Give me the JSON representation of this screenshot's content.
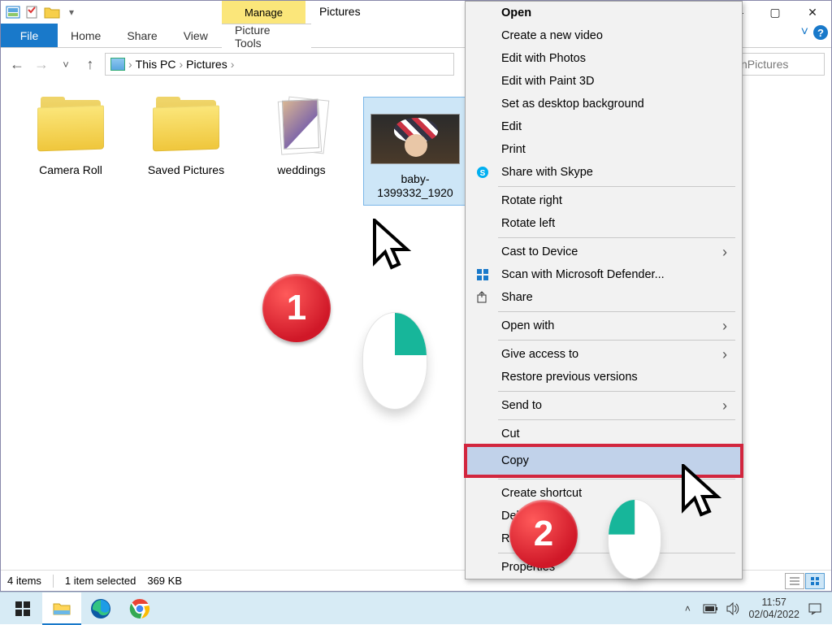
{
  "titlebar": {
    "contextual_tab": "Manage",
    "title": "Pictures"
  },
  "win_controls": {
    "min": "—",
    "max": "▢",
    "close": "✕"
  },
  "ribbon": {
    "file": "File",
    "tabs": [
      "Home",
      "Share",
      "View"
    ],
    "context_tab": "Picture Tools",
    "expand_glyph": "˅",
    "help_glyph": "?"
  },
  "nav": {
    "back_glyph": "←",
    "fwd_glyph": "→",
    "recent_glyph": "˅",
    "up_glyph": "↑",
    "sep_glyph": "›",
    "crumbs": [
      "This PC",
      "Pictures"
    ],
    "search_placeholder": "Pictures",
    "search_prefix_visible": "n "
  },
  "items": [
    {
      "label": "Camera Roll",
      "type": "folder"
    },
    {
      "label": "Saved Pictures",
      "type": "folder"
    },
    {
      "label": "weddings",
      "type": "folder_sheaf"
    },
    {
      "label": "baby-1399332_1920",
      "type": "image",
      "selected": true
    }
  ],
  "statusbar": {
    "count": "4 items",
    "selection": "1 item selected",
    "size": "369 KB"
  },
  "context_menu": {
    "groups": [
      [
        {
          "label": "Open",
          "bold": true
        },
        {
          "label": "Create a new video"
        },
        {
          "label": "Edit with Photos"
        },
        {
          "label": "Edit with Paint 3D"
        },
        {
          "label": "Set as desktop background"
        },
        {
          "label": "Edit"
        },
        {
          "label": "Print"
        },
        {
          "label": "Share with Skype",
          "icon": "skype"
        }
      ],
      [
        {
          "label": "Rotate right"
        },
        {
          "label": "Rotate left"
        }
      ],
      [
        {
          "label": "Cast to Device",
          "submenu": true
        },
        {
          "label": "Scan with Microsoft Defender...",
          "icon": "defender"
        },
        {
          "label": "Share",
          "icon": "share"
        }
      ],
      [
        {
          "label": "Open with",
          "submenu": true
        }
      ],
      [
        {
          "label": "Give access to",
          "submenu": true
        },
        {
          "label": "Restore previous versions"
        }
      ],
      [
        {
          "label": "Send to",
          "submenu": true
        }
      ],
      [
        {
          "label": "Cut"
        },
        {
          "label": "Copy",
          "highlight": true
        }
      ],
      [
        {
          "label": "Create shortcut"
        },
        {
          "label": "Delete"
        },
        {
          "label": "Rename"
        }
      ],
      [
        {
          "label": "Properties"
        }
      ]
    ],
    "submenu_glyph": "›"
  },
  "annotations": {
    "step1": "1",
    "step2": "2"
  },
  "taskbar": {
    "time": "11:57",
    "date": "02/04/2022"
  }
}
